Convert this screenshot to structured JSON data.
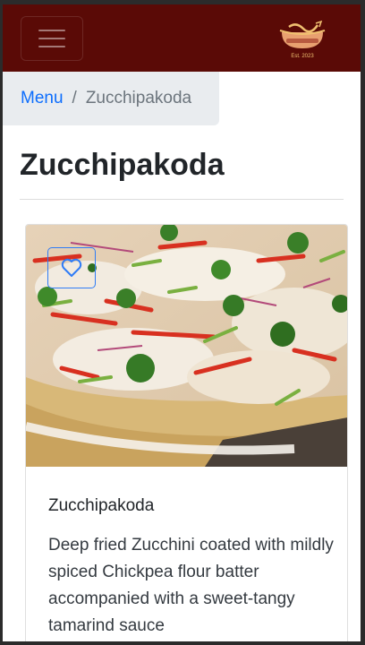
{
  "navbar": {
    "toggler_icon": "hamburger-menu-icon",
    "logo_icon": "restaurant-logo-icon",
    "logo_text": "Est. 2023",
    "color": "#5a0a06"
  },
  "breadcrumb": {
    "menu_label": "Menu",
    "separator": "/",
    "current": "Zucchipakoda"
  },
  "page": {
    "title": "Zucchipakoda"
  },
  "item": {
    "image": "zucchini-pizza-photo",
    "favorite_icon": "heart-icon",
    "name": "Zucchipakoda",
    "description": "Deep fried Zucchini coated with mildly spiced Chickpea flour batter accompanied with a sweet-tangy tamarind sauce"
  },
  "colors": {
    "accent": "#0d6efd",
    "navbar": "#5a0a06"
  }
}
